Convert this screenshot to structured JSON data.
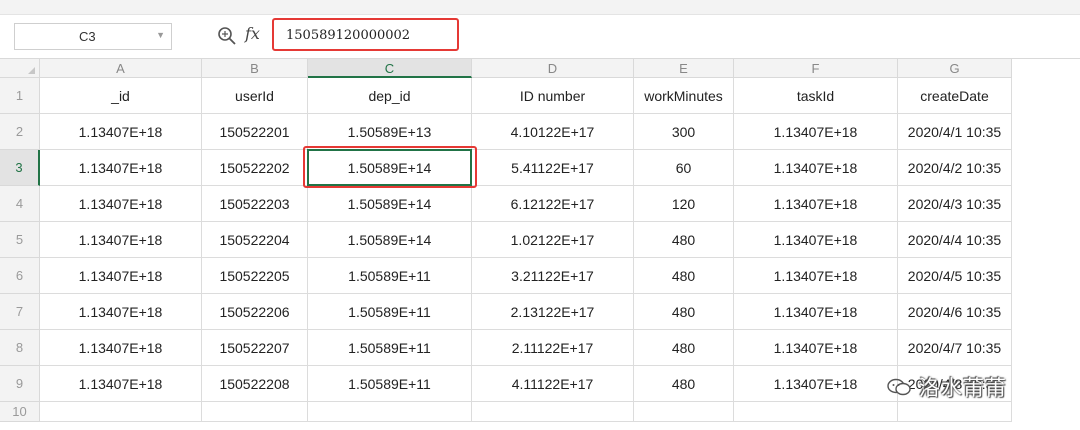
{
  "name_box": {
    "value": "C3"
  },
  "formula": {
    "fx_label": "fx",
    "value": "150589120000002"
  },
  "columns": [
    "A",
    "B",
    "C",
    "D",
    "E",
    "F",
    "G"
  ],
  "active_column": "C",
  "rows": [
    "1",
    "2",
    "3",
    "4",
    "5",
    "6",
    "7",
    "8",
    "9",
    "10"
  ],
  "active_row": "3",
  "sheet": [
    [
      "_id",
      "userId",
      "dep_id",
      "ID number",
      "workMinutes",
      "taskId",
      "createDate"
    ],
    [
      "1.13407E+18",
      "150522201",
      "1.50589E+13",
      "4.10122E+17",
      "300",
      "1.13407E+18",
      "2020/4/1 10:35"
    ],
    [
      "1.13407E+18",
      "150522202",
      "1.50589E+14",
      "5.41122E+17",
      "60",
      "1.13407E+18",
      "2020/4/2 10:35"
    ],
    [
      "1.13407E+18",
      "150522203",
      "1.50589E+14",
      "6.12122E+17",
      "120",
      "1.13407E+18",
      "2020/4/3 10:35"
    ],
    [
      "1.13407E+18",
      "150522204",
      "1.50589E+14",
      "1.02122E+17",
      "480",
      "1.13407E+18",
      "2020/4/4 10:35"
    ],
    [
      "1.13407E+18",
      "150522205",
      "1.50589E+11",
      "3.21122E+17",
      "480",
      "1.13407E+18",
      "2020/4/5 10:35"
    ],
    [
      "1.13407E+18",
      "150522206",
      "1.50589E+11",
      "2.13122E+17",
      "480",
      "1.13407E+18",
      "2020/4/6 10:35"
    ],
    [
      "1.13407E+18",
      "150522207",
      "1.50589E+11",
      "2.11122E+17",
      "480",
      "1.13407E+18",
      "2020/4/7 10:35"
    ],
    [
      "1.13407E+18",
      "150522208",
      "1.50589E+11",
      "4.11122E+17",
      "480",
      "1.13407E+18",
      "2020/4/8 10:35"
    ],
    [
      "",
      "",
      "",
      "",
      "",
      "",
      ""
    ]
  ],
  "watermark": {
    "text": "洛水莆莆"
  },
  "colors": {
    "selection": "#217346",
    "highlight": "#e53935"
  }
}
